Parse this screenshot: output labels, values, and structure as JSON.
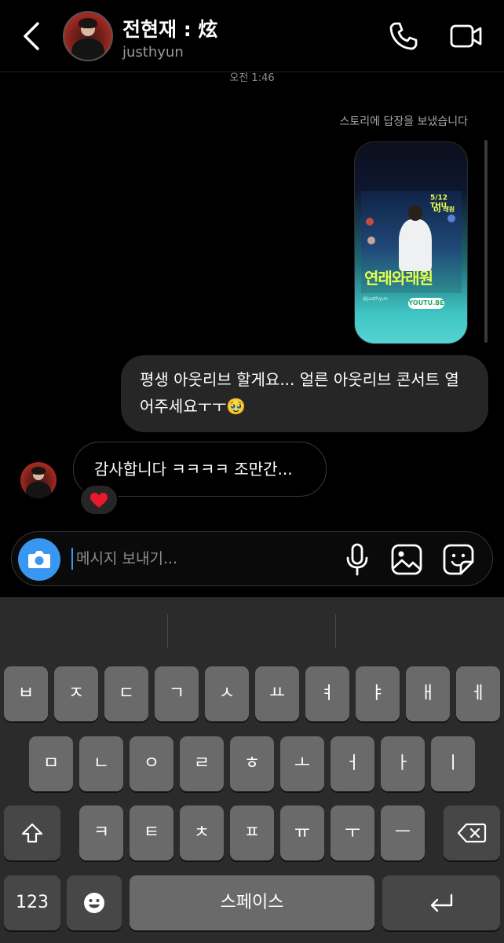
{
  "header": {
    "name": "전현재 : 炫",
    "username": "justhyun"
  },
  "chat": {
    "timestamp": "오전 1:46",
    "story_reply_note": "스토리에 답장을 보냈습니다",
    "story": {
      "date": "5/12 THU.",
      "dj": "DJ 래원",
      "title": "연래와래원",
      "tag": "@justhyun",
      "link": "YOUTU.BE"
    },
    "outgoing_message": "평생 아웃리브 할게요... 얼른 아웃리브 콘서트 열어주세요ㅜㅜ🥹",
    "incoming_message": "감사합니다 ㅋㅋㅋㅋ 조만간...",
    "reaction": "❤️"
  },
  "composer": {
    "placeholder": "메시지 보내기..."
  },
  "keyboard": {
    "row1": [
      "ㅂ",
      "ㅈ",
      "ㄷ",
      "ㄱ",
      "ㅅ",
      "ㅛ",
      "ㅕ",
      "ㅑ",
      "ㅐ",
      "ㅔ"
    ],
    "row2": [
      "ㅁ",
      "ㄴ",
      "ㅇ",
      "ㄹ",
      "ㅎ",
      "ㅗ",
      "ㅓ",
      "ㅏ",
      "ㅣ"
    ],
    "row3": [
      "ㅋ",
      "ㅌ",
      "ㅊ",
      "ㅍ",
      "ㅠ",
      "ㅜ",
      "ㅡ"
    ],
    "numbers_label": "123",
    "space_label": "스페이스"
  },
  "icons": {
    "back": "chevron-left-icon",
    "call": "phone-icon",
    "video": "video-camera-icon",
    "camera": "camera-icon",
    "mic": "microphone-icon",
    "gallery": "image-icon",
    "sticker": "sticker-icon",
    "shift": "shift-icon",
    "backspace": "backspace-icon",
    "emoji": "emoji-icon",
    "return": "return-icon"
  },
  "colors": {
    "accent": "#3897f0",
    "bubble": "#262626",
    "background": "#000000",
    "keyboard": "#2b2b2b",
    "key": "#6a6a6a",
    "key_dark": "#474747"
  }
}
